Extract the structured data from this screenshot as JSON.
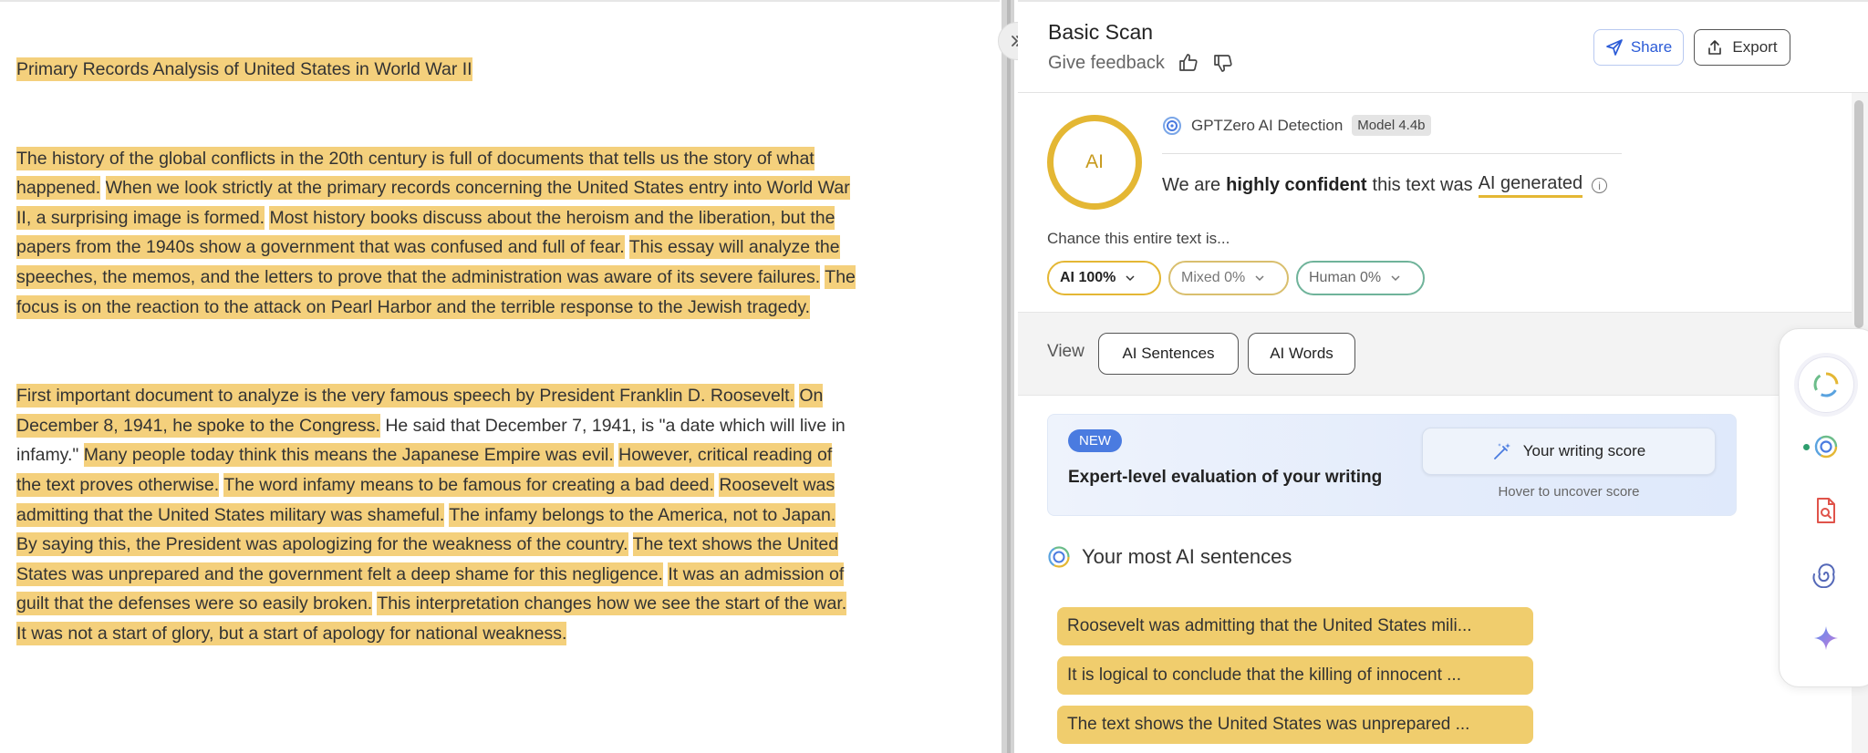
{
  "document": {
    "title": "Primary Records Analysis of United States in World War II",
    "paragraphs": [
      [
        {
          "text": "The history of the global conflicts in the 20th century is full of documents that tells us the story of what happened.",
          "highlight": true
        },
        {
          "text": " ",
          "highlight": false
        },
        {
          "text": "When we look strictly at the primary records concerning the United States entry into World War II, a surprising image is formed.",
          "highlight": true
        },
        {
          "text": " ",
          "highlight": false
        },
        {
          "text": "Most history books discuss about the heroism and the liberation, but the papers from the 1940s show a government that was confused and full of fear.",
          "highlight": true
        },
        {
          "text": " ",
          "highlight": false
        },
        {
          "text": "This essay will analyze the speeches, the memos, and the letters to prove that the administration was aware of its severe failures.",
          "highlight": true
        },
        {
          "text": " ",
          "highlight": false
        },
        {
          "text": "The focus is on the reaction to the attack on Pearl Harbor and the terrible response to the Jewish tragedy.",
          "highlight": true
        }
      ],
      [
        {
          "text": "First important document to analyze is the very famous speech by President Franklin D. Roosevelt.",
          "highlight": true
        },
        {
          "text": " ",
          "highlight": false
        },
        {
          "text": "On December 8, 1941, he spoke to the Congress.",
          "highlight": true
        },
        {
          "text": " He said that December 7, 1941, is \"a date which will live in infamy.\" ",
          "highlight": false
        },
        {
          "text": "Many people today think this means the Japanese Empire was evil.",
          "highlight": true
        },
        {
          "text": " ",
          "highlight": false
        },
        {
          "text": "However, critical reading of the text proves otherwise.",
          "highlight": true
        },
        {
          "text": " ",
          "highlight": false
        },
        {
          "text": "The word infamy means to be famous for creating a bad deed.",
          "highlight": true
        },
        {
          "text": " ",
          "highlight": false
        },
        {
          "text": "Roosevelt was admitting that the United States military was shameful.",
          "highlight": true
        },
        {
          "text": " ",
          "highlight": false
        },
        {
          "text": "The infamy belongs to the America, not to Japan.",
          "highlight": true
        },
        {
          "text": " ",
          "highlight": false
        },
        {
          "text": "By saying this, the President was apologizing for the weakness of the country.",
          "highlight": true
        },
        {
          "text": " ",
          "highlight": false
        },
        {
          "text": "The text shows the United States was unprepared and the government felt a deep shame for this negligence.",
          "highlight": true
        },
        {
          "text": " ",
          "highlight": false
        },
        {
          "text": "It was an admission of guilt that the defenses were so easily broken.",
          "highlight": true
        },
        {
          "text": " ",
          "highlight": false
        },
        {
          "text": "This interpretation changes how we see the start of the war.",
          "highlight": true
        },
        {
          "text": " ",
          "highlight": false
        },
        {
          "text": "It was not a start of glory, but a start of apology for national weakness.",
          "highlight": true
        }
      ]
    ]
  },
  "panel": {
    "title": "Basic Scan",
    "feedback_label": "Give feedback",
    "share_label": "Share",
    "export_label": "Export",
    "detector_name": "GPTZero AI Detection",
    "model_badge": "Model 4.4b",
    "ai_circle_label": "AI",
    "confidence": {
      "prefix": "We are",
      "level": "highly confident",
      "middle": "this text was",
      "verdict": "AI generated"
    },
    "chance_label": "Chance this entire text is...",
    "pills": {
      "ai": "AI 100%",
      "mixed": "Mixed 0%",
      "human": "Human 0%"
    },
    "view_label": "View",
    "view_buttons": [
      "AI Sentences",
      "AI Words"
    ],
    "promo": {
      "badge": "NEW",
      "text": "Expert-level evaluation of your writing",
      "button": "Your writing score",
      "hint": "Hover to uncover score"
    },
    "most_ai_title": "Your most AI sentences",
    "most_ai_sentences": [
      "Roosevelt was admitting that the United States mili...",
      "It is logical to conclude that the killing of innocent ...",
      "The text shows the United States was unprepared ..."
    ]
  },
  "colors": {
    "highlight": "#f4d07c",
    "ai_yellow": "#e4b734",
    "human_green": "#6fb39a",
    "link_blue": "#2b5bd7"
  },
  "icons": {
    "collapse": "double-chevron-right-icon",
    "thumbs_up": "thumbs-up-icon",
    "thumbs_down": "thumbs-down-icon",
    "share": "send-icon",
    "export": "upload-icon",
    "info": "info-icon",
    "writing_score": "magic-wand-icon",
    "dock": [
      "loading-ring-icon",
      "gptzero-logo-icon",
      "document-search-icon",
      "spiral-icon",
      "sparkle-icon"
    ]
  }
}
